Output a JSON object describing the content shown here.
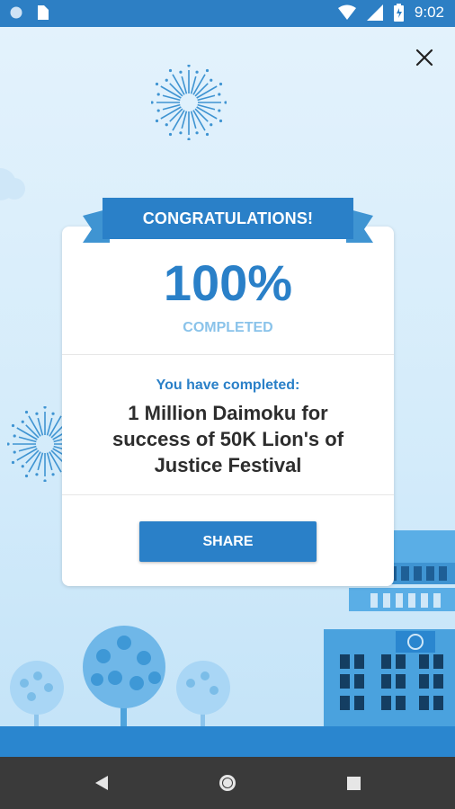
{
  "status_bar": {
    "time": "9:02"
  },
  "dialog": {
    "ribbon_title": "CONGRATULATIONS!",
    "percent": "100%",
    "completed_label": "COMPLETED",
    "you_completed": "You have completed:",
    "task_text": "1 Million Daimoku for success of 50K Lion's of Justice Festival",
    "share_label": "SHARE"
  },
  "colors": {
    "accent": "#2a80c8",
    "status_bar": "#2d7fc4",
    "nav_bar": "#3a3a3a"
  },
  "icons": [
    "wifi-icon",
    "signal-icon",
    "battery-icon",
    "close-icon",
    "back-icon",
    "home-icon",
    "recents-icon"
  ]
}
